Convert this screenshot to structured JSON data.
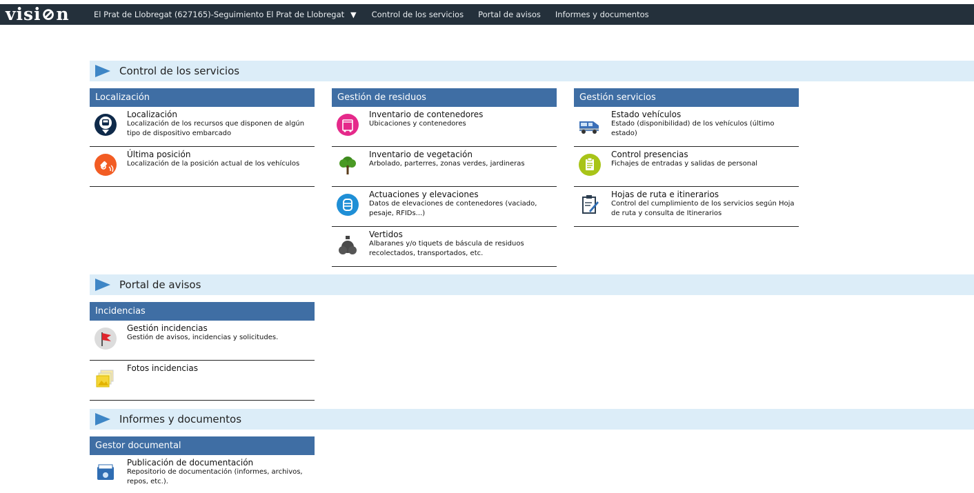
{
  "brand": "visi⊘n",
  "nav": {
    "location": "El Prat de Llobregat (627165)-Seguimiento El Prat de Llobregat",
    "items": [
      "Control de los servicios",
      "Portal de avisos",
      "Informes y documentos"
    ]
  },
  "sections": {
    "control": {
      "title": "Control de los servicios",
      "localizacion": {
        "header": "Localización",
        "entries": [
          {
            "title": "Localización",
            "desc": "Localización de los recursos que disponen de algún tipo de dispositivo embarcado",
            "icon": "bus-pin-icon"
          },
          {
            "title": "Última posición",
            "desc": "Localización de la posición actual de los vehículos",
            "icon": "satellite-icon"
          }
        ]
      },
      "residuos": {
        "header": "Gestión de residuos",
        "entries": [
          {
            "title": "Inventario de contenedores",
            "desc": "Ubicaciones y contenedores",
            "icon": "container-icon"
          },
          {
            "title": "Inventario de vegetación",
            "desc": "Arbolado, parterres, zonas verdes, jardineras",
            "icon": "tree-icon"
          },
          {
            "title": "Actuaciones y elevaciones",
            "desc": "Datos de elevaciones de contenedores (vaciado, pesaje, RFIDs...)",
            "icon": "lift-icon"
          },
          {
            "title": "Vertidos",
            "desc": "Albaranes y/o tiquets de báscula de residuos recolectados, transportados, etc.",
            "icon": "waste-bag-icon"
          }
        ]
      },
      "servicios": {
        "header": "Gestión servicios",
        "entries": [
          {
            "title": "Estado vehículos",
            "desc": "Estado (disponibilidad) de los vehículos (último estado)",
            "icon": "van-icon"
          },
          {
            "title": "Control presencias",
            "desc": "Fichajes de entradas y salidas de personal",
            "icon": "clipboard-icon"
          },
          {
            "title": "Hojas de ruta e itinerarios",
            "desc": "Control del cumplimiento de los servicios según Hoja de ruta y consulta de Itinerarios",
            "icon": "route-sheet-icon"
          }
        ]
      }
    },
    "avisos": {
      "title": "Portal de avisos",
      "incidencias": {
        "header": "Incidencias",
        "entries": [
          {
            "title": "Gestión incidencias",
            "desc": "Gestión de avisos, incidencias y solicitudes.",
            "icon": "flag-icon"
          },
          {
            "title": "Fotos incidencias",
            "desc": "",
            "icon": "photos-icon"
          }
        ]
      }
    },
    "informes": {
      "title": "Informes y documentos",
      "gestor": {
        "header": "Gestor documental",
        "entries": [
          {
            "title": "Publicación de documentación",
            "desc": "Repositorio de documentación (informes, archivos, repos, etc.).",
            "icon": "document-folder-icon"
          }
        ]
      }
    }
  },
  "colors": {
    "topbar": "#24303b",
    "section_bg": "#dcedf8",
    "column_header": "#3f6ea4",
    "arrow": "#3e86c6"
  }
}
